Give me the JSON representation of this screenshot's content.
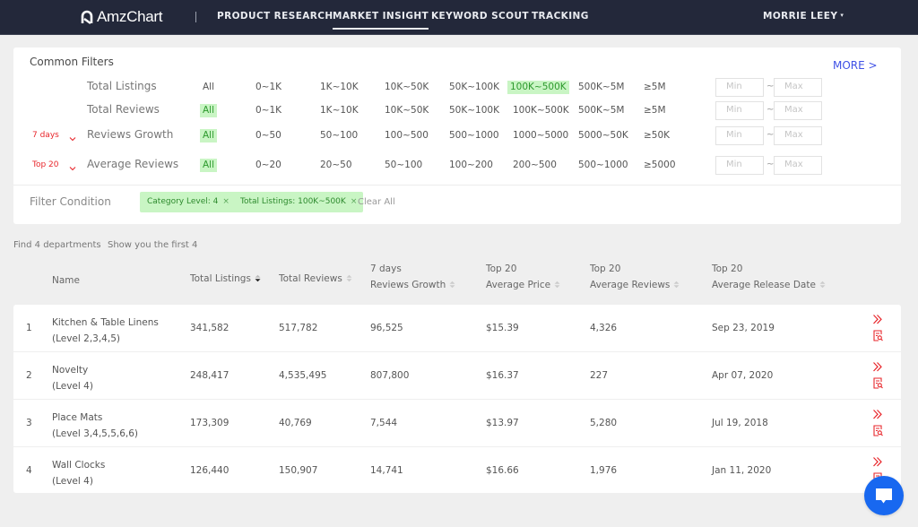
{
  "app": {
    "logo_text": "AmzChart"
  },
  "nav": {
    "items": [
      {
        "label": "PRODUCT RESEARCH",
        "active": false
      },
      {
        "label": "MARKET INSIGHT",
        "active": true
      },
      {
        "label": "KEYWORD SCOUT",
        "active": false
      },
      {
        "label": "TRACKING",
        "active": false
      }
    ],
    "user_name": "MORRIE LEEY",
    "user_caret": "▾"
  },
  "filters": {
    "title": "Common Filters",
    "more_label": "MORE >",
    "rows": [
      {
        "prefix": "",
        "label": "Total Listings",
        "options": [
          "All",
          "0~1K",
          "1K~10K",
          "10K~50K",
          "50K~100K",
          "100K~500K",
          "500K~5M",
          "≥5M"
        ],
        "selected": "100K~500K",
        "min_placeholder": "Min",
        "max_placeholder": "Max"
      },
      {
        "prefix": "",
        "label": "Total Reviews",
        "options": [
          "All",
          "0~1K",
          "1K~10K",
          "10K~50K",
          "50K~100K",
          "100K~500K",
          "500K~5M",
          "≥5M"
        ],
        "selected": "All",
        "min_placeholder": "Min",
        "max_placeholder": "Max"
      },
      {
        "prefix": "7 days",
        "label": "Reviews Growth",
        "options": [
          "All",
          "0~50",
          "50~100",
          "100~500",
          "500~1000",
          "1000~5000",
          "5000~50K",
          "≥50K"
        ],
        "selected": "All",
        "min_placeholder": "Min",
        "max_placeholder": "Max"
      },
      {
        "prefix": "Top 20",
        "label": "Average Reviews",
        "options": [
          "All",
          "0~20",
          "20~50",
          "50~100",
          "100~200",
          "200~500",
          "500~1000",
          "≥5000"
        ],
        "selected": "All",
        "min_placeholder": "Min",
        "max_placeholder": "Max"
      }
    ],
    "range_separator": "~",
    "condition_label": "Filter Condition",
    "conditions": [
      "Category Level: 4",
      "Total Listings: 100K~500K"
    ],
    "chip_close": "×",
    "clear_all": "Clear All"
  },
  "summary": {
    "found": "Find 4 departments",
    "showing": "Show you the first 4"
  },
  "table": {
    "columns": [
      {
        "line1": "",
        "line2": "Name",
        "sortable": false
      },
      {
        "line1": "",
        "line2": "Total Listings",
        "sortable": true,
        "sort_active": true
      },
      {
        "line1": "",
        "line2": "Total Reviews",
        "sortable": true
      },
      {
        "line1": "7 days",
        "line2": "Reviews Growth",
        "sortable": true
      },
      {
        "line1": "Top 20",
        "line2": "Average Price",
        "sortable": true
      },
      {
        "line1": "Top 20",
        "line2": "Average Reviews",
        "sortable": true
      },
      {
        "line1": "Top 20",
        "line2": "Average Release Date",
        "sortable": true
      }
    ],
    "rows": [
      {
        "index": "1",
        "name": "Kitchen & Table Linens",
        "level": "(Level 2,3,4,5)",
        "total_listings": "341,582",
        "total_reviews": "517,782",
        "reviews_growth": "96,525",
        "avg_price": "$15.39",
        "avg_reviews": "4,326",
        "avg_release_date": "Sep 23, 2019"
      },
      {
        "index": "2",
        "name": "Novelty",
        "level": "(Level 4)",
        "total_listings": "248,417",
        "total_reviews": "4,535,495",
        "reviews_growth": "807,800",
        "avg_price": "$16.37",
        "avg_reviews": "227",
        "avg_release_date": "Apr 07, 2020"
      },
      {
        "index": "3",
        "name": "Place Mats",
        "level": "(Level 3,4,5,5,6,6)",
        "total_listings": "173,309",
        "total_reviews": "40,769",
        "reviews_growth": "7,544",
        "avg_price": "$13.97",
        "avg_reviews": "5,280",
        "avg_release_date": "Jul 19, 2018"
      },
      {
        "index": "4",
        "name": "Wall Clocks",
        "level": "(Level 4)",
        "total_listings": "126,440",
        "total_reviews": "150,907",
        "reviews_growth": "14,741",
        "avg_price": "$16.66",
        "avg_reviews": "1,976",
        "avg_release_date": "Jan 11, 2020"
      }
    ]
  },
  "colors": {
    "nav_bg": "#23283a",
    "accent_red": "#e8262b",
    "selected_green_bg": "#c9f5c4",
    "selected_green_text": "#2d9a2d",
    "link_blue": "#3f51e6",
    "chat_blue": "#1868f0"
  }
}
